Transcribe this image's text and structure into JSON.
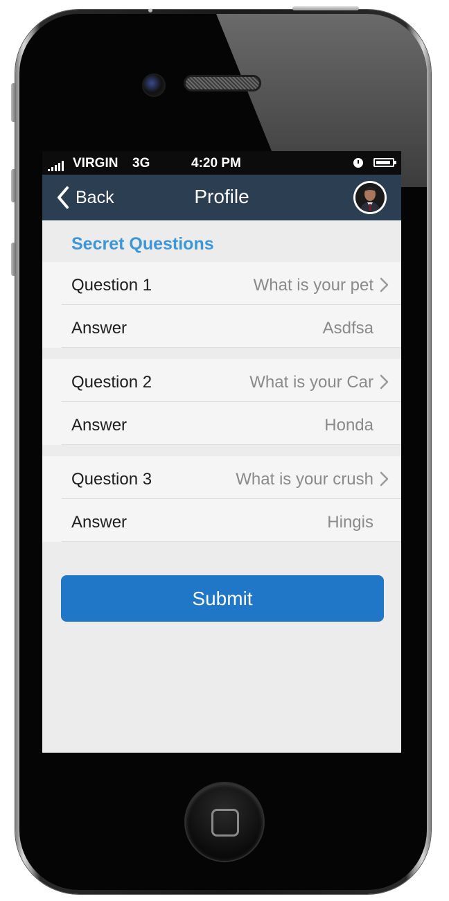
{
  "status_bar": {
    "carrier": "VIRGIN",
    "network": "3G",
    "time": "4:20 PM"
  },
  "nav": {
    "back_label": "Back",
    "title": "Profile"
  },
  "section": {
    "title": "Secret Questions"
  },
  "questions": [
    {
      "question_label": "Question 1",
      "question_value": "What is your pet",
      "answer_label": "Answer",
      "answer_value": "Asdfsa"
    },
    {
      "question_label": "Question 2",
      "question_value": "What is your Car",
      "answer_label": "Answer",
      "answer_value": "Honda"
    },
    {
      "question_label": "Question 3",
      "question_value": "What is your crush",
      "answer_label": "Answer",
      "answer_value": "Hingis"
    }
  ],
  "submit_label": "Submit",
  "colors": {
    "nav_background": "#2c3e52",
    "section_title": "#3c96d7",
    "submit_button": "#2077c8"
  },
  "icons": [
    "signal-icon",
    "alarm-icon",
    "battery-icon",
    "back-chevron-icon",
    "chevron-right-icon",
    "home-button-icon"
  ]
}
